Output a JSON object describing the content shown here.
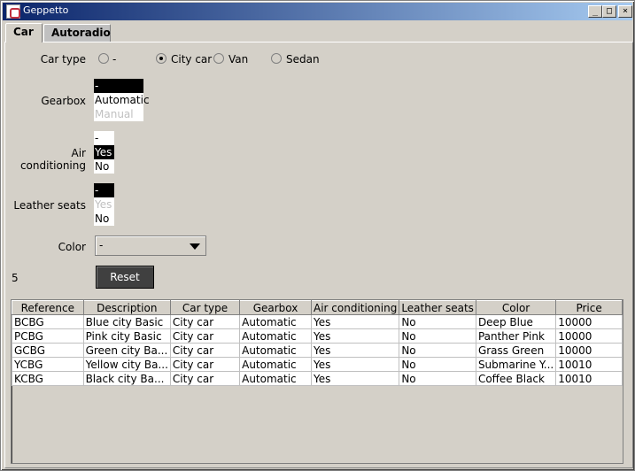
{
  "window": {
    "title": "Geppetto"
  },
  "tabs": [
    {
      "label": "Car"
    },
    {
      "label": "Autoradio"
    }
  ],
  "form": {
    "car_type": {
      "label": "Car type",
      "options": [
        {
          "label": "-",
          "checked": false
        },
        {
          "label": "City car",
          "checked": true
        },
        {
          "label": "Van",
          "checked": false
        },
        {
          "label": "Sedan",
          "checked": false
        }
      ]
    },
    "gearbox": {
      "label": "Gearbox",
      "items": [
        "-",
        "Automatic",
        "Manual"
      ]
    },
    "air_conditioning": {
      "label": "Air conditioning",
      "items": [
        "-",
        "Yes",
        "No"
      ]
    },
    "leather_seats": {
      "label": "Leather seats",
      "items": [
        "-",
        "Yes",
        "No"
      ]
    },
    "color": {
      "label": "Color",
      "value": "-"
    },
    "result_count": "5",
    "reset_label": "Reset"
  },
  "table": {
    "columns": [
      "Reference",
      "Description",
      "Car type",
      "Gearbox",
      "Air conditioning",
      "Leather seats",
      "Color",
      "Price"
    ],
    "rows": [
      [
        "BCBG",
        "Blue city Basic",
        "City car",
        "Automatic",
        "Yes",
        "No",
        "Deep Blue",
        "10000"
      ],
      [
        "PCBG",
        "Pink city Basic",
        "City car",
        "Automatic",
        "Yes",
        "No",
        "Panther Pink",
        "10000"
      ],
      [
        "GCBG",
        "Green city Ba...",
        "City car",
        "Automatic",
        "Yes",
        "No",
        "Grass Green",
        "10000"
      ],
      [
        "YCBG",
        "Yellow city Ba...",
        "City car",
        "Automatic",
        "Yes",
        "No",
        "Submarine Y...",
        "10010"
      ],
      [
        "KCBG",
        "Black city Ba...",
        "City car",
        "Automatic",
        "Yes",
        "No",
        "Coffee Black",
        "10010"
      ]
    ]
  },
  "colors": {
    "title_start": "#0a246a",
    "title_end": "#a6caf0",
    "selection": "#000000",
    "window_bg": "#d4d0c8"
  }
}
